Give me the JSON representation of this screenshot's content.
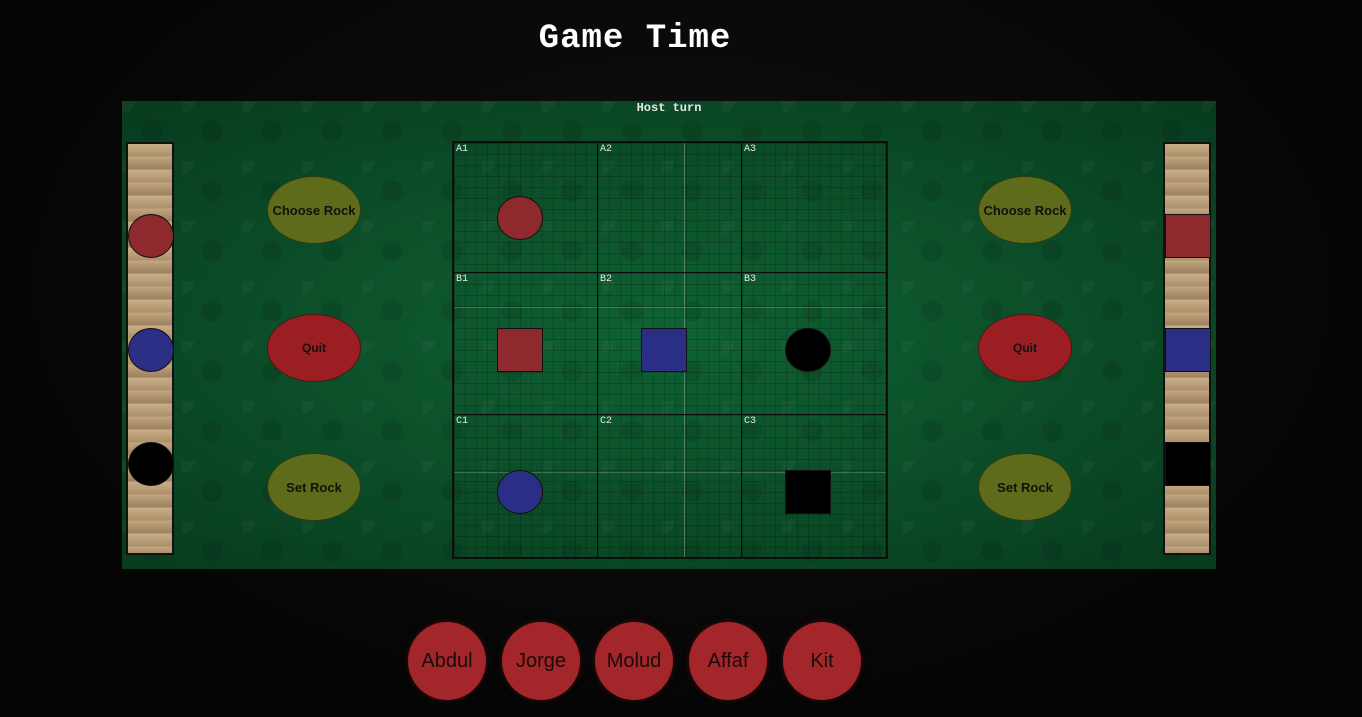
{
  "title": "Game Time",
  "turn_text": "Host turn",
  "colors": {
    "red": "#8e2a2e",
    "blue": "#2a2f85",
    "black": "#000000",
    "olive_button": "#5e6b1a",
    "red_button": "#9b1f22",
    "player_button": "#a3262a",
    "felt": "#0c5a2e"
  },
  "left_panel": {
    "choose_label": "Choose Rock",
    "quit_label": "Quit",
    "set_label": "Set Rock",
    "rack": [
      "red",
      "blue",
      "black"
    ],
    "rack_shape": "circle"
  },
  "right_panel": {
    "choose_label": "Choose Rock",
    "quit_label": "Quit",
    "set_label": "Set Rock",
    "rack": [
      "red",
      "blue",
      "black"
    ],
    "rack_shape": "square"
  },
  "board": {
    "cells": [
      {
        "label": "A1",
        "piece": {
          "shape": "circle",
          "color": "red"
        }
      },
      {
        "label": "A2",
        "piece": null
      },
      {
        "label": "A3",
        "piece": null
      },
      {
        "label": "B1",
        "piece": {
          "shape": "square",
          "color": "red"
        }
      },
      {
        "label": "B2",
        "piece": {
          "shape": "square",
          "color": "blue"
        }
      },
      {
        "label": "B3",
        "piece": {
          "shape": "circle",
          "color": "black"
        }
      },
      {
        "label": "C1",
        "piece": {
          "shape": "circle",
          "color": "blue"
        }
      },
      {
        "label": "C2",
        "piece": null
      },
      {
        "label": "C3",
        "piece": {
          "shape": "square",
          "color": "black"
        }
      }
    ]
  },
  "players": [
    "Abdul",
    "Jorge",
    "Molud",
    "Affaf",
    "Kit"
  ]
}
